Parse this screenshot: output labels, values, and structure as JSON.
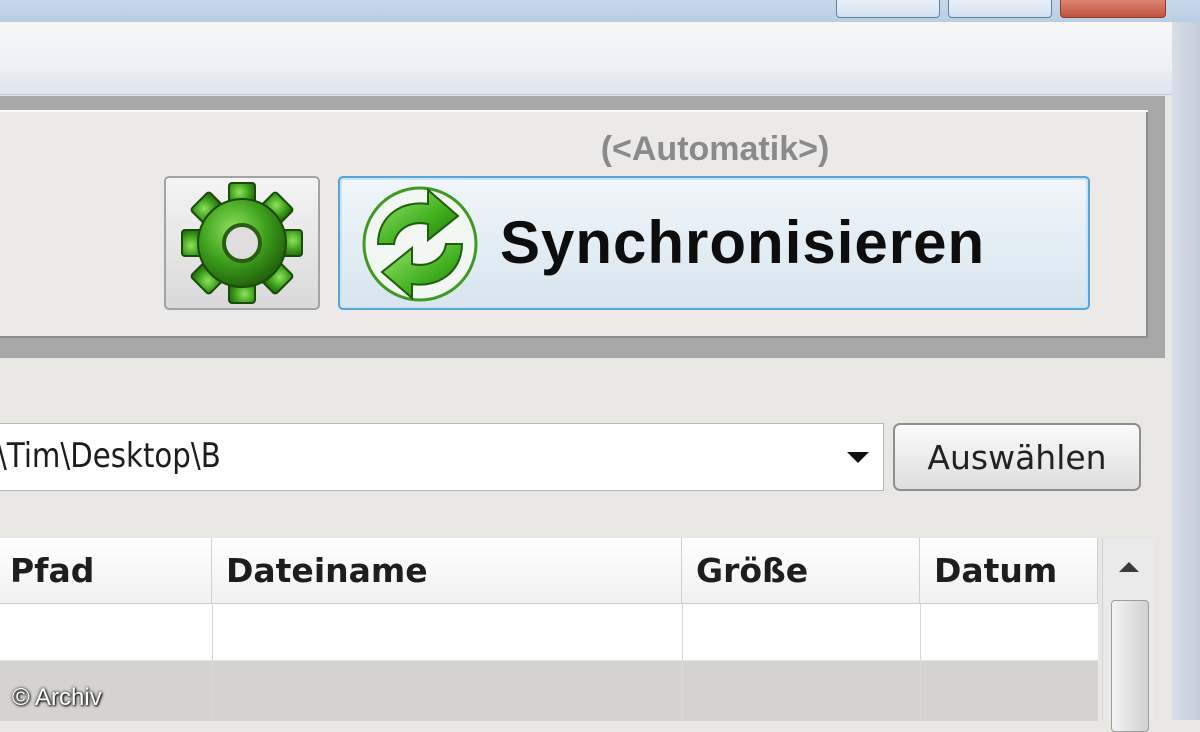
{
  "toolbar": {
    "mode_label": "(<Automatik>)",
    "settings_icon": "gear-icon",
    "sync_icon": "sync-arrows-icon",
    "sync_label": "Synchronisieren"
  },
  "folder_picker": {
    "path_value": "\\Tim\\Desktop\\B",
    "choose_label": "Auswählen"
  },
  "file_table": {
    "columns": [
      "Pfad",
      "Dateiname",
      "Größe",
      "Datum"
    ],
    "rows": []
  },
  "watermark": "© Archiv",
  "colors": {
    "accent_green": "#3fae1e",
    "button_focus_border": "#5aa3d6"
  }
}
